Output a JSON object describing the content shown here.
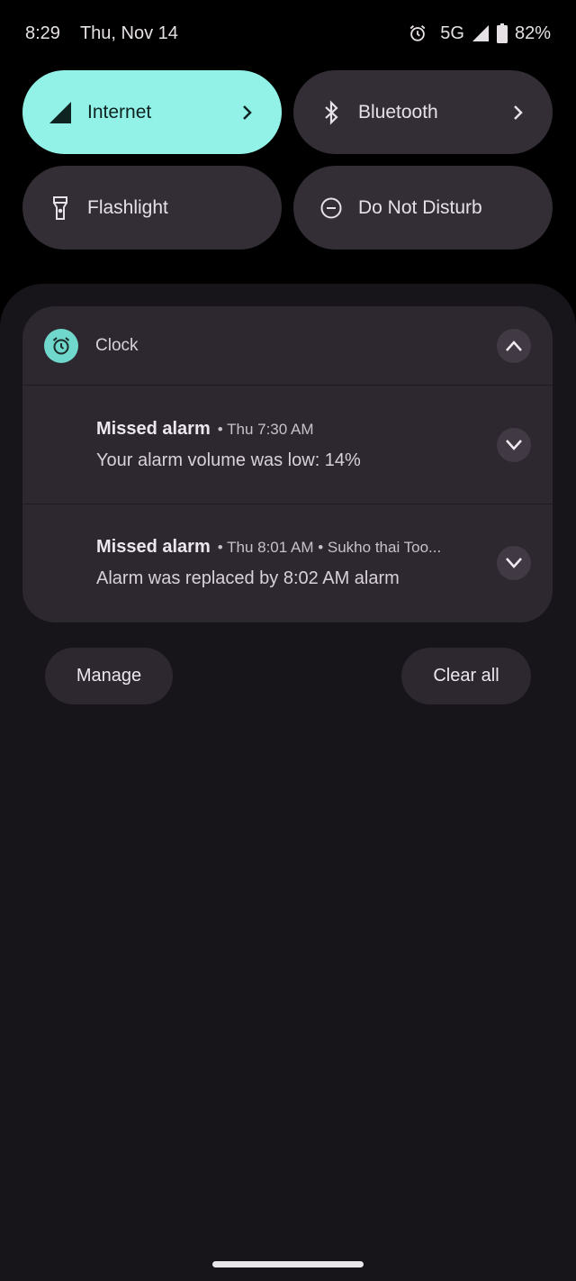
{
  "status_bar": {
    "time": "8:29",
    "date": "Thu, Nov 14",
    "network": "5G",
    "battery": "82%",
    "icons": [
      "alarm-icon",
      "signal-icon",
      "battery-icon"
    ]
  },
  "quick_tiles": [
    {
      "label": "Internet",
      "icon": "cellular-signal-icon",
      "active": true,
      "has_chevron": true
    },
    {
      "label": "Bluetooth",
      "icon": "bluetooth-icon",
      "active": false,
      "has_chevron": true
    },
    {
      "label": "Flashlight",
      "icon": "flashlight-icon",
      "active": false,
      "has_chevron": false
    },
    {
      "label": "Do Not Disturb",
      "icon": "do-not-disturb-icon",
      "active": false,
      "has_chevron": false
    }
  ],
  "notification_group": {
    "app_name": "Clock",
    "app_icon": "alarm-clock-icon",
    "accent": "#6fd7cb",
    "items": [
      {
        "title": "Missed alarm",
        "meta": "• Thu 7:30 AM",
        "body": "Your alarm volume was low: 14%"
      },
      {
        "title": "Missed alarm",
        "meta": "• Thu 8:01 AM • Sukho thai Too...",
        "body": "Alarm was replaced by 8:02 AM alarm"
      }
    ]
  },
  "footer": {
    "manage_label": "Manage",
    "clear_all_label": "Clear all"
  },
  "colors": {
    "active_tile": "#92f2e8",
    "tile": "#332d35",
    "shade": "#17141a",
    "card": "#2d2830"
  }
}
